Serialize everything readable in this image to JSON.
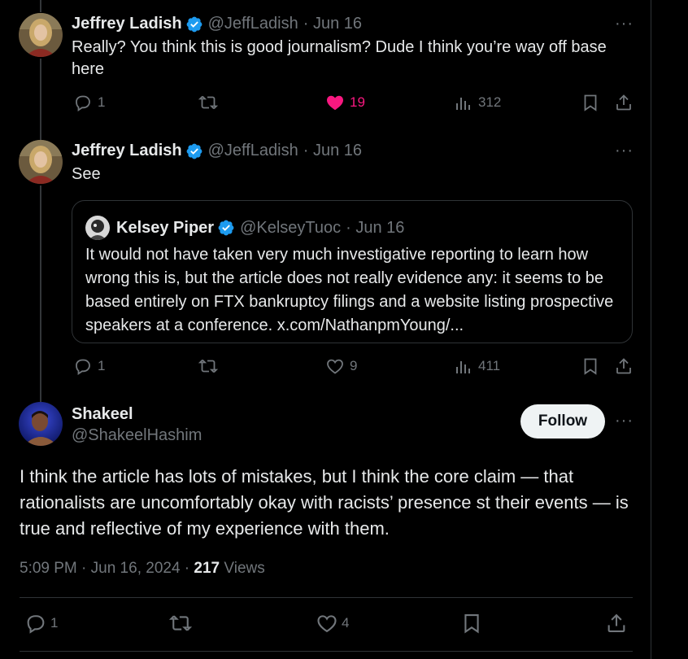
{
  "tweets": [
    {
      "author": "Jeffrey Ladish",
      "handle": "@JeffLadish",
      "time": "· Jun 16",
      "text": "Really? You think this is good journalism? Dude I think you’re way off base here",
      "actions": {
        "replies": "1",
        "reposts": "",
        "likes": "19",
        "views": "312"
      }
    },
    {
      "author": "Jeffrey Ladish",
      "handle": "@JeffLadish",
      "time": "· Jun 16",
      "text": "See",
      "actions": {
        "replies": "1",
        "reposts": "",
        "likes": "9",
        "views": "411"
      },
      "quote": {
        "author": "Kelsey Piper",
        "handle": "@KelseyTuoc",
        "time": "· Jun 16",
        "text": "It would not have taken very much investigative reporting to learn how wrong this is, but the article does not really evidence any: it seems to be based entirely on FTX bankruptcy filings and a website listing prospective speakers at a conference. x.com/NathanpmYoung/..."
      }
    }
  ],
  "main": {
    "author": "Shakeel",
    "handle": "@ShakeelHashim",
    "follow_label": "Follow",
    "text": "I think the article has lots of mistakes, but I think the core claim — that rationalists are uncomfortably okay with racists’ presence st their events — is true and reflective of my experience with them.",
    "timestamp": "5:09 PM · Jun 16, 2024 ·",
    "views_count": "217",
    "views_label": "Views",
    "actions": {
      "replies": "1",
      "reposts": "",
      "likes": "4"
    }
  },
  "more_label": "···",
  "colors": {
    "accent": "#1d9bf0",
    "like": "#f91880",
    "muted": "#71767b",
    "background": "#000000"
  }
}
